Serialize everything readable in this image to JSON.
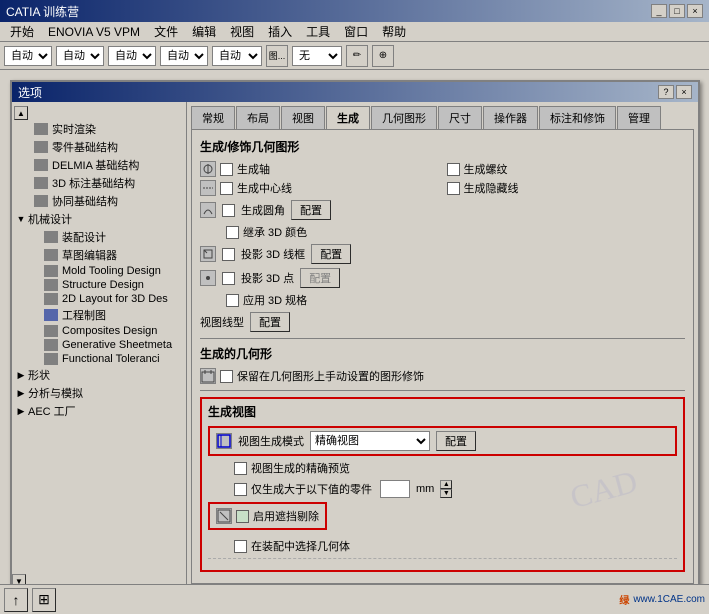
{
  "titlebar": {
    "title": "CATIA 训练营",
    "buttons": [
      "_",
      "□",
      "×"
    ]
  },
  "menubar": {
    "items": [
      "开始",
      "ENOVIA V5 VPM",
      "文件",
      "编辑",
      "视图",
      "插入",
      "工具",
      "窗口",
      "帮助"
    ]
  },
  "toolbar": {
    "selects": [
      "自动",
      "自动",
      "自动",
      "自动",
      "自动"
    ],
    "select_placeholder": "自动"
  },
  "dialog": {
    "title": "选项",
    "help_btn": "?",
    "close_btn": "×"
  },
  "left_panel": {
    "items": [
      {
        "label": "实时渲染",
        "indent": 1,
        "has_icon": true
      },
      {
        "label": "零件基础结构",
        "indent": 1,
        "has_icon": true
      },
      {
        "label": "DELMIA 基础结构",
        "indent": 1,
        "has_icon": true
      },
      {
        "label": "3D 标注基础结构",
        "indent": 1,
        "has_icon": true
      },
      {
        "label": "协同基础结构",
        "indent": 1,
        "has_icon": true
      },
      {
        "label": "机械设计",
        "indent": 0,
        "is_group": true
      },
      {
        "label": "装配设计",
        "indent": 1,
        "has_icon": true
      },
      {
        "label": "草图编辑器",
        "indent": 1,
        "has_icon": true
      },
      {
        "label": "Mold Tooling Design",
        "indent": 1,
        "has_icon": true
      },
      {
        "label": "Structure Design",
        "indent": 1,
        "has_icon": true
      },
      {
        "label": "2D Layout for 3D Des",
        "indent": 1,
        "has_icon": true
      },
      {
        "label": "工程制图",
        "indent": 1,
        "has_icon": true,
        "active": true
      },
      {
        "label": "Composites Design",
        "indent": 1,
        "has_icon": true
      },
      {
        "label": "Generative Sheetmeta",
        "indent": 1,
        "has_icon": true
      },
      {
        "label": "Functional Toleranci",
        "indent": 1,
        "has_icon": true
      },
      {
        "label": "形状",
        "indent": 0,
        "is_group": true
      },
      {
        "label": "分析与模拟",
        "indent": 0,
        "is_group": true
      },
      {
        "label": "AEC 工厂",
        "indent": 0,
        "is_group": true
      }
    ]
  },
  "tabs": {
    "items": [
      "常规",
      "布局",
      "视图",
      "生成",
      "几何图形",
      "尺寸",
      "操作器",
      "标注和修饰",
      "管理"
    ],
    "active": "生成"
  },
  "tab_content": {
    "section1_title": "生成/修饰几何图形",
    "options_col1": [
      "生成轴",
      "生成中心线",
      "生成圆角",
      "继承 3D 颜色",
      "投影 3D 点",
      "应用 3D 规格"
    ],
    "options_col2": [
      "生成螺纹",
      "生成隐藏线",
      "",
      "投影 3D 线框",
      ""
    ],
    "config_buttons": [
      "配置",
      "配置",
      "配置"
    ],
    "view_line_type_label": "视图线型",
    "view_line_config": "配置",
    "section2_title": "生成的几何形",
    "section2_option": "保留在几何图形上手动设置的图形修饰",
    "section3_title": "生成视图",
    "view_gen_mode_label": "视图生成模式",
    "view_gen_mode_value": "精确视图",
    "view_gen_config": "配置",
    "option_preview": "视图生成的精确预览",
    "option_large": "仅生成大于以下值的零件",
    "option_hidden": "启用遮挡剔除",
    "option_select": "在装配中选择几何体"
  },
  "watermark": "CAD",
  "bottom": {
    "icon": "↑",
    "logo": "www.1CAE.com"
  }
}
